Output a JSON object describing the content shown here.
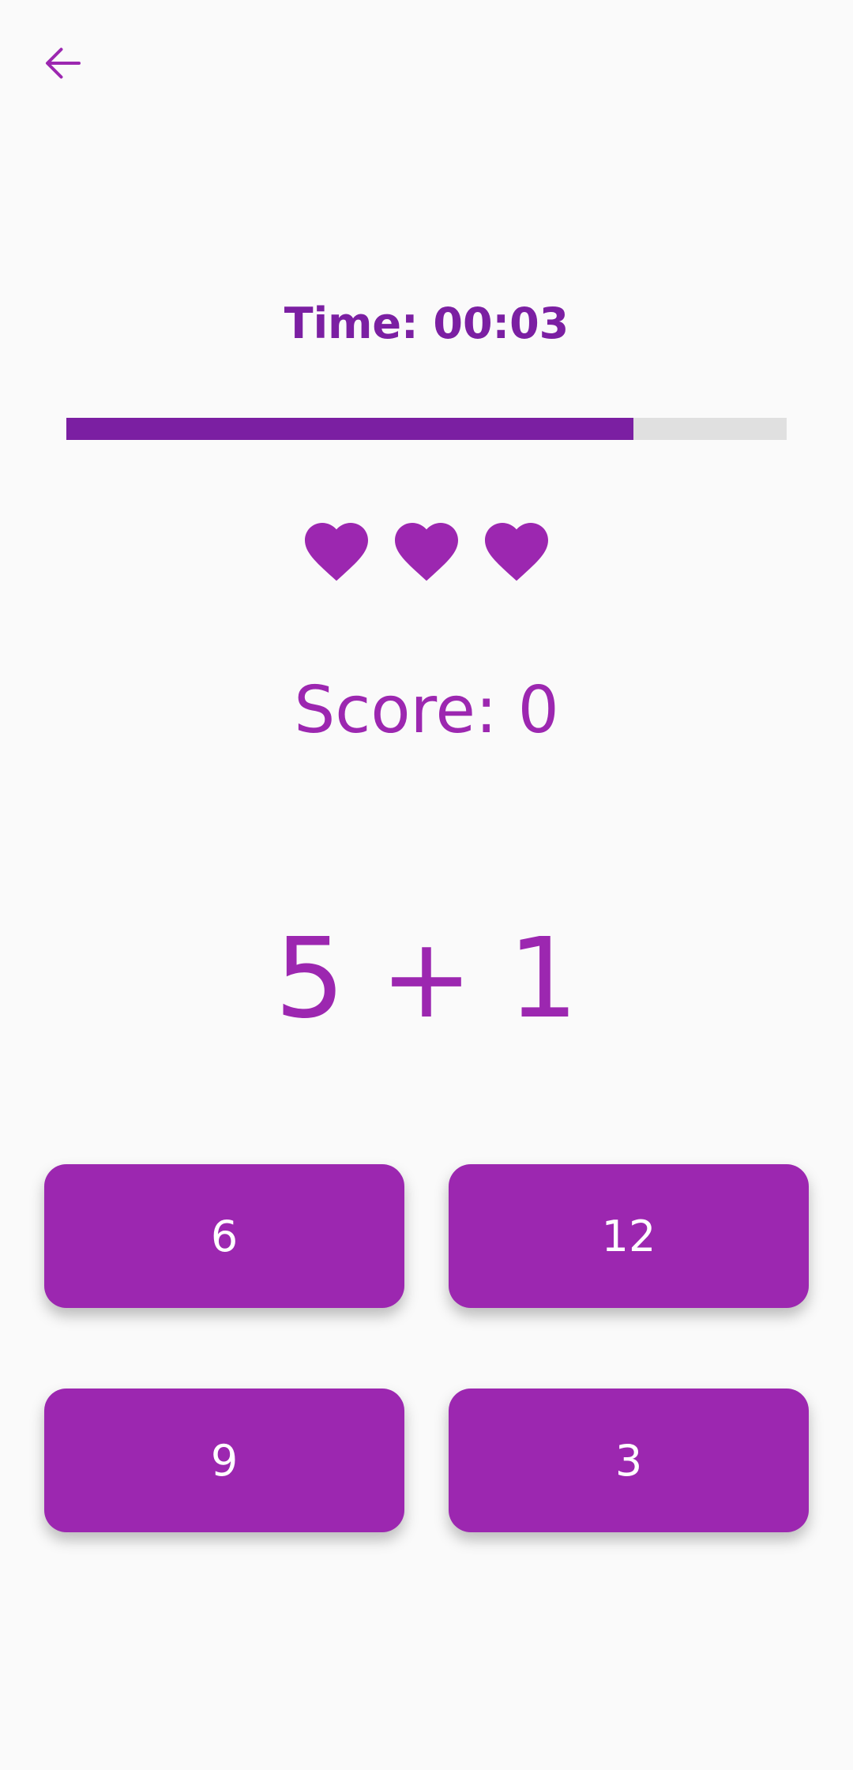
{
  "header": {
    "back_icon": "arrow-left-icon"
  },
  "game": {
    "timer_label": "Time: 00:03",
    "time_progress": 0.787,
    "lives": 3,
    "heart_icon": "heart-icon",
    "score_label": "Score: 0",
    "question": "5 + 1",
    "answers": [
      "6",
      "12",
      "9",
      "3"
    ]
  },
  "colors": {
    "primary": "#9c27b0",
    "primary_dark": "#7b1fa2",
    "track": "#e0e0e0",
    "background": "#fafafa"
  }
}
